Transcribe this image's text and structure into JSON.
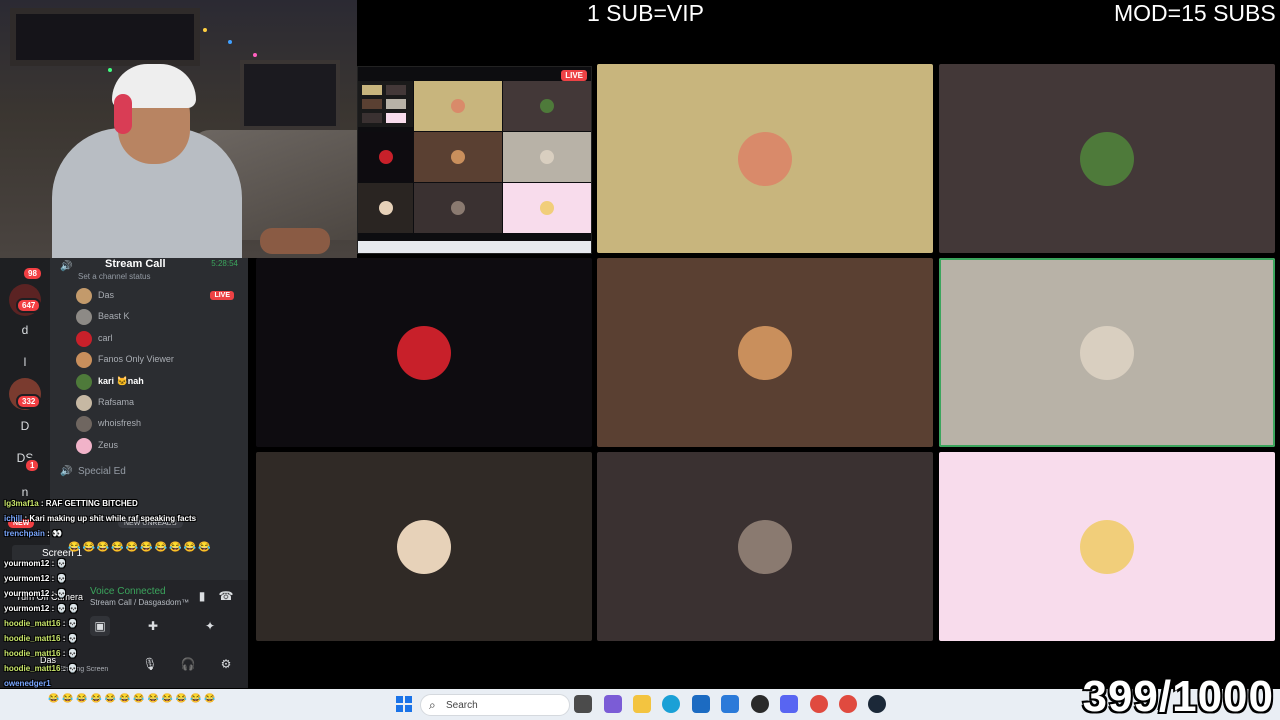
{
  "overlay": {
    "vip_text": "1 SUB=VIP",
    "mod_text": "MOD=15 SUBS",
    "counter_text": "399/1000"
  },
  "screenshare": {
    "live_label": "LIVE"
  },
  "video_tiles": [
    {
      "name": "tile-1",
      "bg": "#c8b57d",
      "avatar_color": "#d98a6a"
    },
    {
      "name": "tile-2",
      "bg": "#433838",
      "avatar_color": "#4e7a3a"
    },
    {
      "name": "tile-3",
      "bg": "#0e0c10",
      "avatar_color": "#c8202a"
    },
    {
      "name": "tile-4",
      "bg": "#5a4032",
      "avatar_color": "#c98f5c"
    },
    {
      "name": "tile-5",
      "bg": "#b8b2a7",
      "avatar_color": "#d9cfc0"
    },
    {
      "name": "tile-6",
      "bg": "#302a26",
      "avatar_color": "#e7d2b9"
    },
    {
      "name": "tile-7",
      "bg": "#3a3131",
      "avatar_color": "#8a7a70"
    },
    {
      "name": "tile-8",
      "bg": "#f8dcec",
      "avatar_color": "#f1ce7a"
    }
  ],
  "servers": {
    "badge_top": "98",
    "badge_2": "647",
    "letter_d": "d",
    "letter_l": "l",
    "badge_332": "332",
    "letter_D": "D",
    "letter_DS": "DS",
    "badge_DS": "1",
    "letter_n": "n"
  },
  "channel": {
    "name": "Stream Call",
    "timer": "5:28:54",
    "status_placeholder": "Set a channel status"
  },
  "members": [
    {
      "name": "Das",
      "color": "#c39a6b",
      "live": "LIVE"
    },
    {
      "name": "Beast K",
      "color": "#8d8a86"
    },
    {
      "name": "carl",
      "color": "#c8202a"
    },
    {
      "name": "Fanos Only Viewer",
      "color": "#c98f5c"
    },
    {
      "name": "kari 🐱nah",
      "color": "#4e7a3a",
      "bold": true
    },
    {
      "name": "Rafsama",
      "color": "#c6b8a3"
    },
    {
      "name": "whoisfresh",
      "color": "#6f6660"
    },
    {
      "name": "Zeus",
      "color": "#f1b3c9"
    }
  ],
  "special_ed": "Special Ed",
  "chat": {
    "new_tag": "NEW",
    "new_unreads": "NEW UNREADS",
    "lines": [
      {
        "user": "lg3maf1a",
        "msg": "RAF GETTING BITCHED"
      },
      {
        "user": "ichill",
        "msg": "Kari making up shit while raf speaking facts"
      },
      {
        "user": "trenchpain",
        "msg": "👀"
      },
      {
        "user": "yourmom12",
        "msg": "💀"
      },
      {
        "user": "yourmom12",
        "msg": "💀"
      },
      {
        "user": "yourmom12",
        "msg": "💀"
      },
      {
        "user": "yourmom12",
        "msg": "💀 💀"
      },
      {
        "user": "hoodie_matt16",
        "msg": "💀"
      },
      {
        "user": "hoodie_matt16",
        "msg": "💀"
      },
      {
        "user": "hoodie_matt16",
        "msg": "💀"
      },
      {
        "user": "hoodie_matt16",
        "msg": "💀"
      },
      {
        "user": "owenedger1",
        "msg": ""
      }
    ],
    "emoji_row": "😂😂😂😂😂😂😂😂😂😂"
  },
  "voice": {
    "connected": "Voice Connected",
    "channel_path": "Stream Call / Dasgasdom™",
    "screen_label": "Screen 1",
    "turn_off_camera": "Turn Off Camera",
    "user_name": "Das",
    "user_status": "Sharing Screen"
  },
  "taskbar": {
    "search_placeholder": "Search",
    "emoji_bar": "😂😂😂😂😂😂😂😂😂😂😂😂"
  }
}
